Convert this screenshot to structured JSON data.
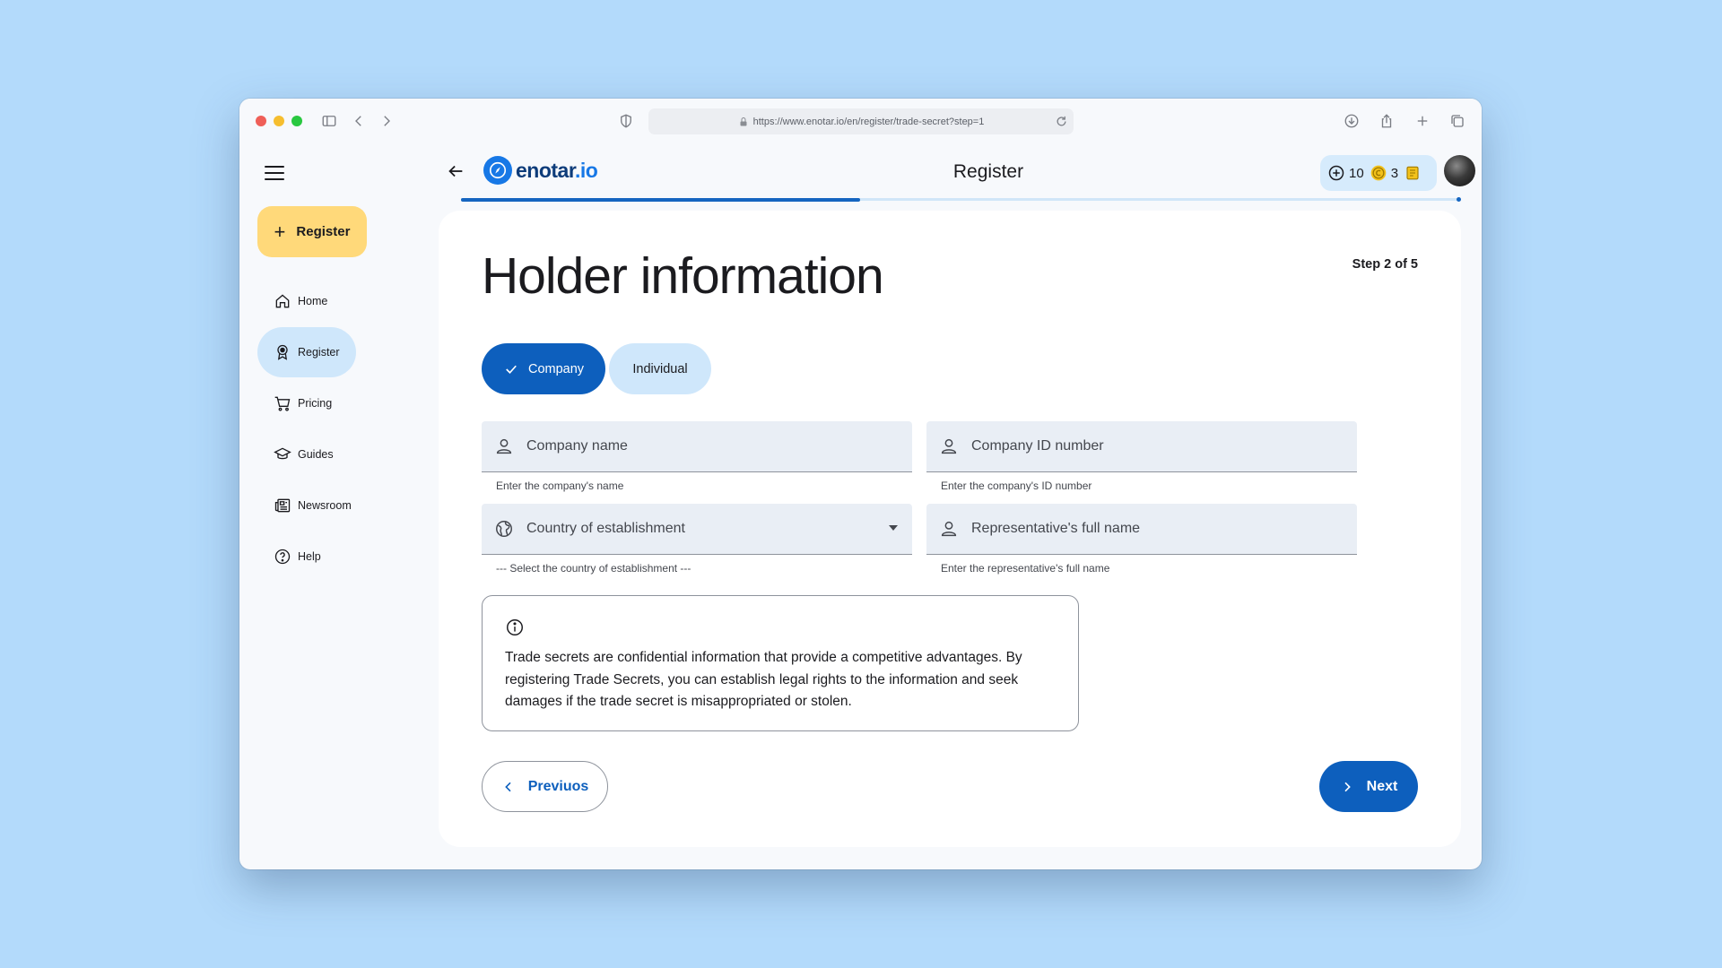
{
  "browser": {
    "url": "https://www.enotar.io/en/register/trade-secret?step=1"
  },
  "sidebar": {
    "fab_label": "Register",
    "items": [
      {
        "label": "Home",
        "icon": "home-icon"
      },
      {
        "label": "Register",
        "icon": "award-icon",
        "active": true
      },
      {
        "label": "Pricing",
        "icon": "cart-icon"
      },
      {
        "label": "Guides",
        "icon": "graduation-cap-icon"
      },
      {
        "label": "Newsroom",
        "icon": "newspaper-icon"
      },
      {
        "label": "Help",
        "icon": "help-circle-icon"
      }
    ]
  },
  "header": {
    "logo_text_main": "enotar",
    "logo_text_accent": ".io",
    "title": "Register",
    "credits": {
      "plus_count": "10",
      "coin_count": "3"
    },
    "progress": 0.4
  },
  "form": {
    "step": "Step 2 of 5",
    "heading": "Holder information",
    "segments": {
      "company": "Company",
      "individual": "Individual",
      "selected": "company"
    },
    "fields": {
      "company_name": {
        "label": "Company name",
        "helper": "Enter the company's name"
      },
      "company_id": {
        "label": "Company ID number",
        "helper": "Enter the company's ID number"
      },
      "country": {
        "label": "Country of establishment",
        "helper": "--- Select the country of establishment ---"
      },
      "representative": {
        "label": "Representative's full name",
        "helper": "Enter the representative's full name"
      }
    },
    "info_text": "Trade secrets are confidential information that provide a competitive advantages. By registering Trade Secrets, you can establish legal rights to the information and seek damages if the trade secret is misappropriated or stolen.",
    "prev_label": "Previuos",
    "next_label": "Next"
  },
  "colors": {
    "primary": "#0d5fbd",
    "fab": "#ffd97a",
    "active_nav": "#cfe7fb",
    "background": "#b3dafb"
  }
}
